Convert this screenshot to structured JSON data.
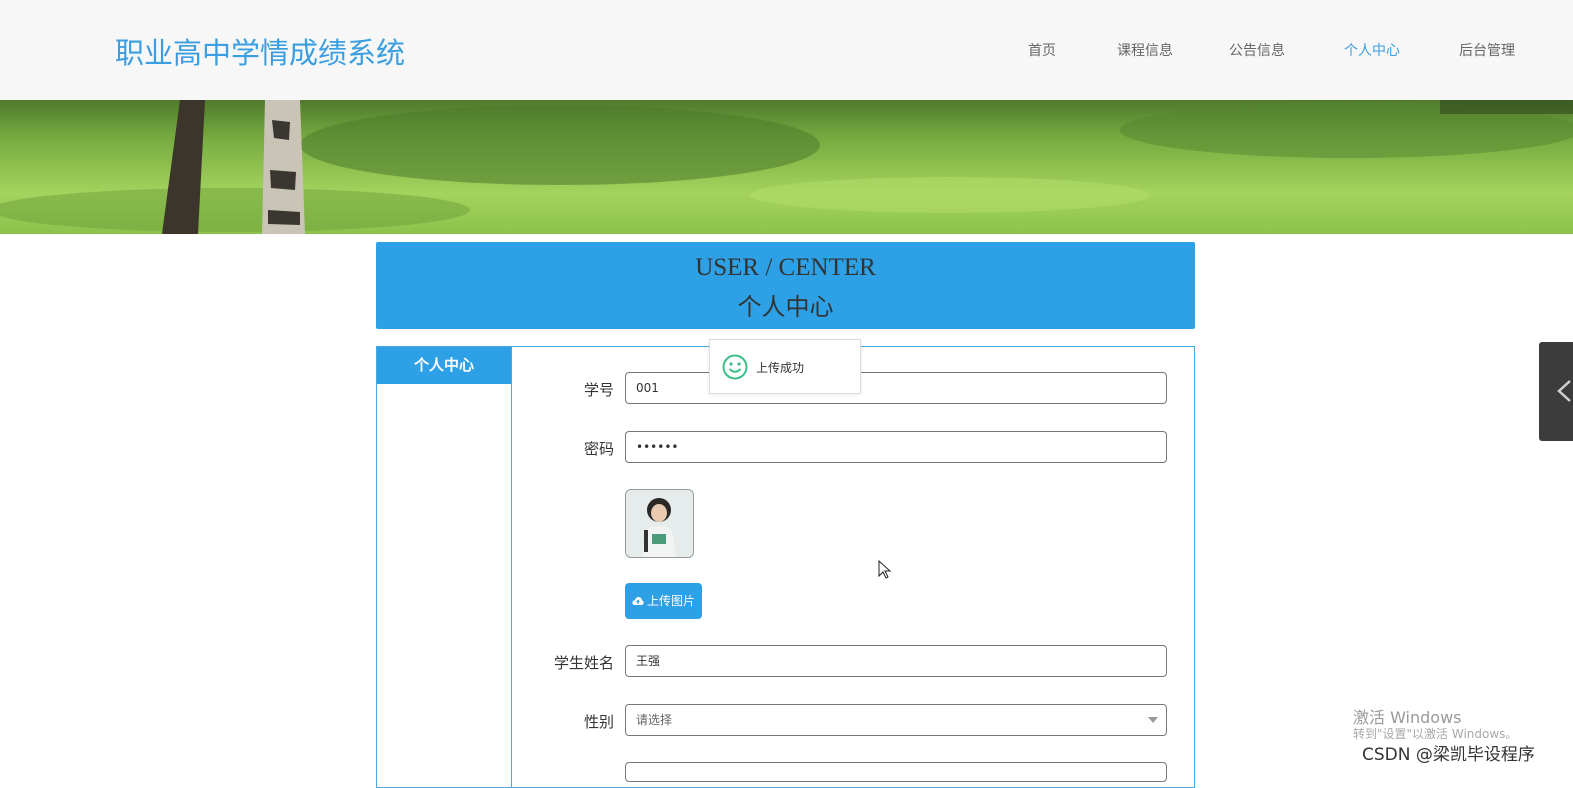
{
  "header": {
    "brand": "职业高中学情成绩系统",
    "nav": [
      {
        "label": "首页",
        "active": false
      },
      {
        "label": "课程信息",
        "active": false
      },
      {
        "label": "公告信息",
        "active": false
      },
      {
        "label": "个人中心",
        "active": true
      },
      {
        "label": "后台管理",
        "active": false
      }
    ]
  },
  "title_block": {
    "en": "USER / CENTER",
    "cn": "个人中心"
  },
  "sidebar": {
    "items": [
      {
        "label": "个人中心",
        "active": true
      }
    ]
  },
  "form": {
    "student_id": {
      "label": "学号",
      "value": "001"
    },
    "password": {
      "label": "密码",
      "value": "••••••"
    },
    "avatar": {
      "alt": "avatar-image"
    },
    "upload_button": {
      "label": "上传图片",
      "icon": "cloud-upload-icon"
    },
    "student_name": {
      "label": "学生姓名",
      "value": "王强"
    },
    "gender": {
      "label": "性别",
      "placeholder": "请选择"
    }
  },
  "toast": {
    "text": "上传成功",
    "icon": "smile-icon"
  },
  "watermark": {
    "line1": "激活 Windows",
    "line2": "转到\"设置\"以激活 Windows。"
  },
  "credit": "CSDN @梁凯毕设程序",
  "colors": {
    "accent": "#2ea1e6",
    "brand": "#3a9ee0",
    "toast_icon": "#3cbf8a"
  }
}
